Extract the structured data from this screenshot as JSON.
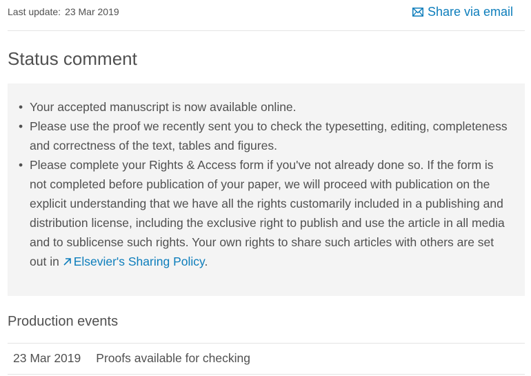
{
  "header": {
    "last_update_label": "Last update:",
    "last_update_date": "23 Mar 2019",
    "share_label": "Share via email",
    "share_icon": "envelope-icon"
  },
  "status": {
    "title": "Status comment",
    "items": [
      "Your accepted manuscript is now available online.",
      "Please use the proof we recently sent you to check the typesetting, editing, completeness and correctness of the text, tables and figures.",
      "Please complete your Rights & Access form if you've not already done so. If the form is not completed before publication of your paper, we will proceed with publication on the explicit understanding that we have all the rights customarily included in a publishing and distribution license, including the exclusive right to publish and use the article in all media and to sublicense such rights. Your own rights to share such articles with others are set out in"
    ],
    "policy_link": "Elsevier's Sharing Policy",
    "policy_suffix": ".",
    "link_icon": "external-arrow-icon"
  },
  "production": {
    "title": "Production events",
    "events": [
      {
        "date": "23 Mar 2019",
        "event": "Proofs available for checking"
      }
    ]
  },
  "colors": {
    "text": "#505050",
    "link": "#0c7dbb",
    "box_background": "#f4f4f4",
    "divider": "#e4e4e4"
  }
}
